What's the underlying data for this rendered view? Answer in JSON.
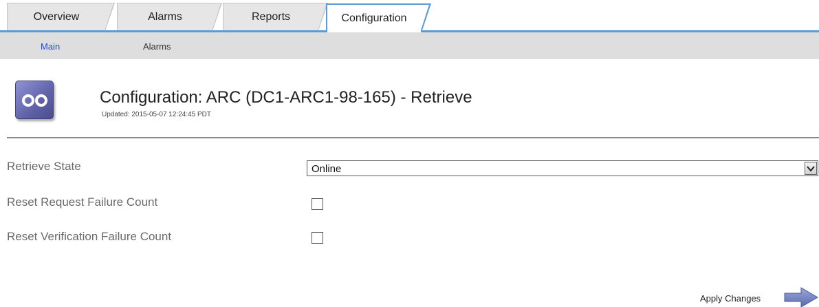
{
  "tabs": [
    {
      "label": "Overview",
      "active": false
    },
    {
      "label": "Alarms",
      "active": false
    },
    {
      "label": "Reports",
      "active": false
    },
    {
      "label": "Configuration",
      "active": true
    }
  ],
  "subtabs": [
    {
      "label": "Main",
      "active": true
    },
    {
      "label": "Alarms",
      "active": false
    }
  ],
  "header": {
    "icon": "archive-tape-icon",
    "title": "Configuration: ARC (DC1-ARC1-98-165) - Retrieve",
    "updated": "Updated: 2015-05-07 12:24:45 PDT"
  },
  "form": {
    "retrieve_state": {
      "label": "Retrieve State",
      "value": "Online"
    },
    "reset_request_failure_count": {
      "label": "Reset Request Failure Count",
      "checked": false
    },
    "reset_verification_failure_count": {
      "label": "Reset Verification Failure Count",
      "checked": false
    }
  },
  "actions": {
    "apply_label": "Apply Changes",
    "apply_icon": "arrow-right-icon"
  },
  "colors": {
    "accent": "#5a9bd5",
    "active_subtab": "#1f4fd1",
    "icon": "#6f72b8"
  }
}
